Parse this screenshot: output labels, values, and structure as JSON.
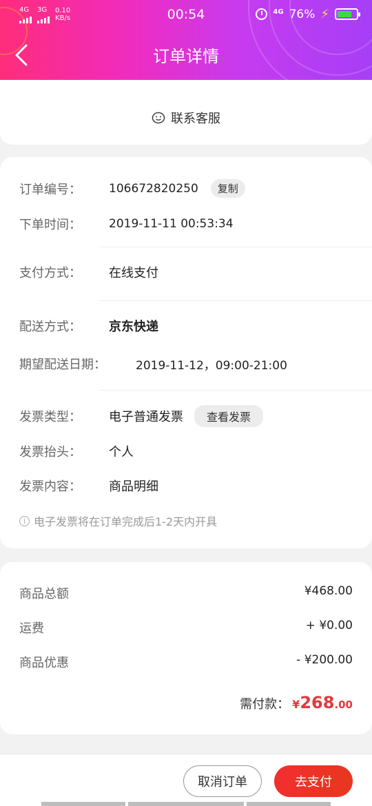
{
  "status_bar": {
    "network1": "4G",
    "network2": "3G",
    "speed_value": "0.10",
    "speed_unit": "KB/s",
    "time": "00:54",
    "net_type": "4G",
    "battery": "76%",
    "battery_level": 0.76
  },
  "header": {
    "title": "订单详情"
  },
  "contact": {
    "label": "联系客服"
  },
  "order": {
    "number_label": "订单编号：",
    "number": "106672820250",
    "copy_label": "复制",
    "time_label": "下单时间：",
    "time": "2019-11-11 00:53:34",
    "payment_label": "支付方式：",
    "payment": "在线支付",
    "delivery_label": "配送方式：",
    "delivery": "京东快递",
    "expected_label": "期望配送日期：",
    "expected": "2019-11-12，09:00-21:00",
    "invoice_type_label": "发票类型：",
    "invoice_type": "电子普通发票",
    "view_invoice_label": "查看发票",
    "invoice_title_label": "发票抬头：",
    "invoice_title": "个人",
    "invoice_content_label": "发票内容：",
    "invoice_content": "商品明细",
    "note": "电子发票将在订单完成后1-2天内开具"
  },
  "fees": {
    "total_label": "商品总额",
    "total": "¥468.00",
    "shipping_label": "运费",
    "shipping": "+ ¥0.00",
    "discount_label": "商品优惠",
    "discount": "- ¥200.00",
    "due_label": "需付款：",
    "due_currency": "¥",
    "due_int": "268",
    "due_dec": ".00"
  },
  "footer": {
    "cancel_label": "取消订单",
    "pay_label": "去支付"
  },
  "colors": {
    "accent": "#e4393c",
    "header_start": "#ff2d7a",
    "header_end": "#a63ff6"
  }
}
